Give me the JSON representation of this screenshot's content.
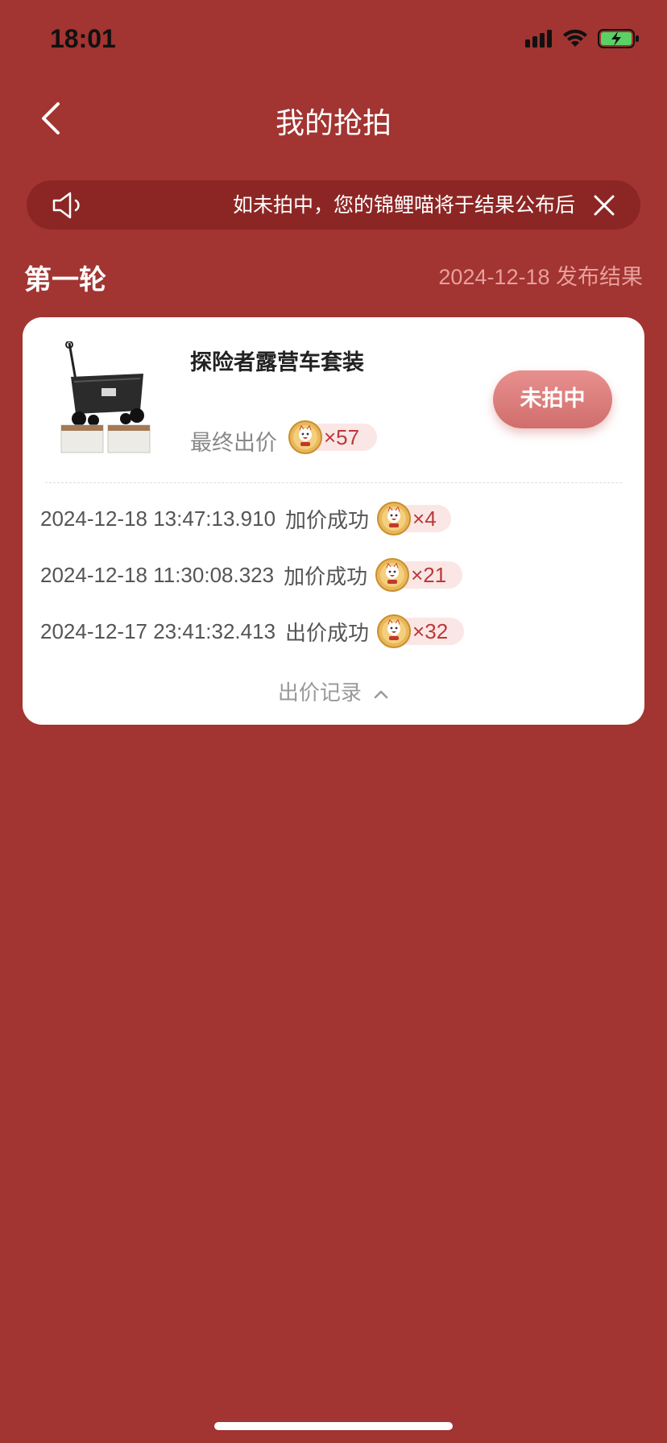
{
  "status_bar": {
    "time": "18:01"
  },
  "nav": {
    "title": "我的抢拍"
  },
  "notice": {
    "text": "如未拍中，您的锦鲤喵将于结果公布后"
  },
  "round": {
    "title": "第一轮",
    "publish": "2024-12-18 发布结果"
  },
  "product": {
    "name": "探险者露营车套装",
    "final_label": "最终出价",
    "final_qty": "×57",
    "status": "未拍中"
  },
  "records": [
    {
      "time": "2024-12-18 13:47:13.910",
      "action": "加价成功",
      "qty": "×4"
    },
    {
      "time": "2024-12-18 11:30:08.323",
      "action": "加价成功",
      "qty": "×21"
    },
    {
      "time": "2024-12-17 23:41:32.413",
      "action": "出价成功",
      "qty": "×32"
    }
  ],
  "records_toggle": {
    "label": "出价记录"
  },
  "colors": {
    "background": "#a23431",
    "accent": "#b93a37",
    "button": "#d96f6d"
  }
}
